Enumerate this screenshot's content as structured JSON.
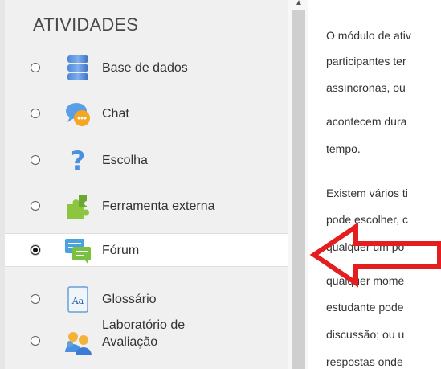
{
  "panel": {
    "title": "ATIVIDADES",
    "items": [
      {
        "label": "Base de dados",
        "selected": false,
        "icon": "database-icon"
      },
      {
        "label": "Chat",
        "selected": false,
        "icon": "chat-icon"
      },
      {
        "label": "Escolha",
        "selected": false,
        "icon": "question-mark-icon"
      },
      {
        "label": "Ferramenta externa",
        "selected": false,
        "icon": "puzzle-icon"
      },
      {
        "label": "Fórum",
        "selected": true,
        "icon": "forum-icon"
      },
      {
        "label": "Glossário",
        "selected": false,
        "icon": "glossary-icon"
      },
      {
        "label": "Laboratório de Avaliação",
        "label_line1": "Laboratório de",
        "label_line2": "Avaliação",
        "selected": false,
        "icon": "workshop-icon"
      }
    ]
  },
  "description": {
    "lines": [
      "O módulo de ativ",
      "participantes ter",
      "assíncronas, ou",
      "acontecem dura",
      "tempo.",
      "Existem vários ti",
      "pode escolher, c",
      "qualquer um po",
      "qualquer mome",
      "estudante pode",
      "discussão; ou u",
      "respostas onde"
    ]
  },
  "colors": {
    "panel_background": "#f0f0f0",
    "selected_row": "#ffffff",
    "annotation_arrow": "#e41e1e"
  }
}
